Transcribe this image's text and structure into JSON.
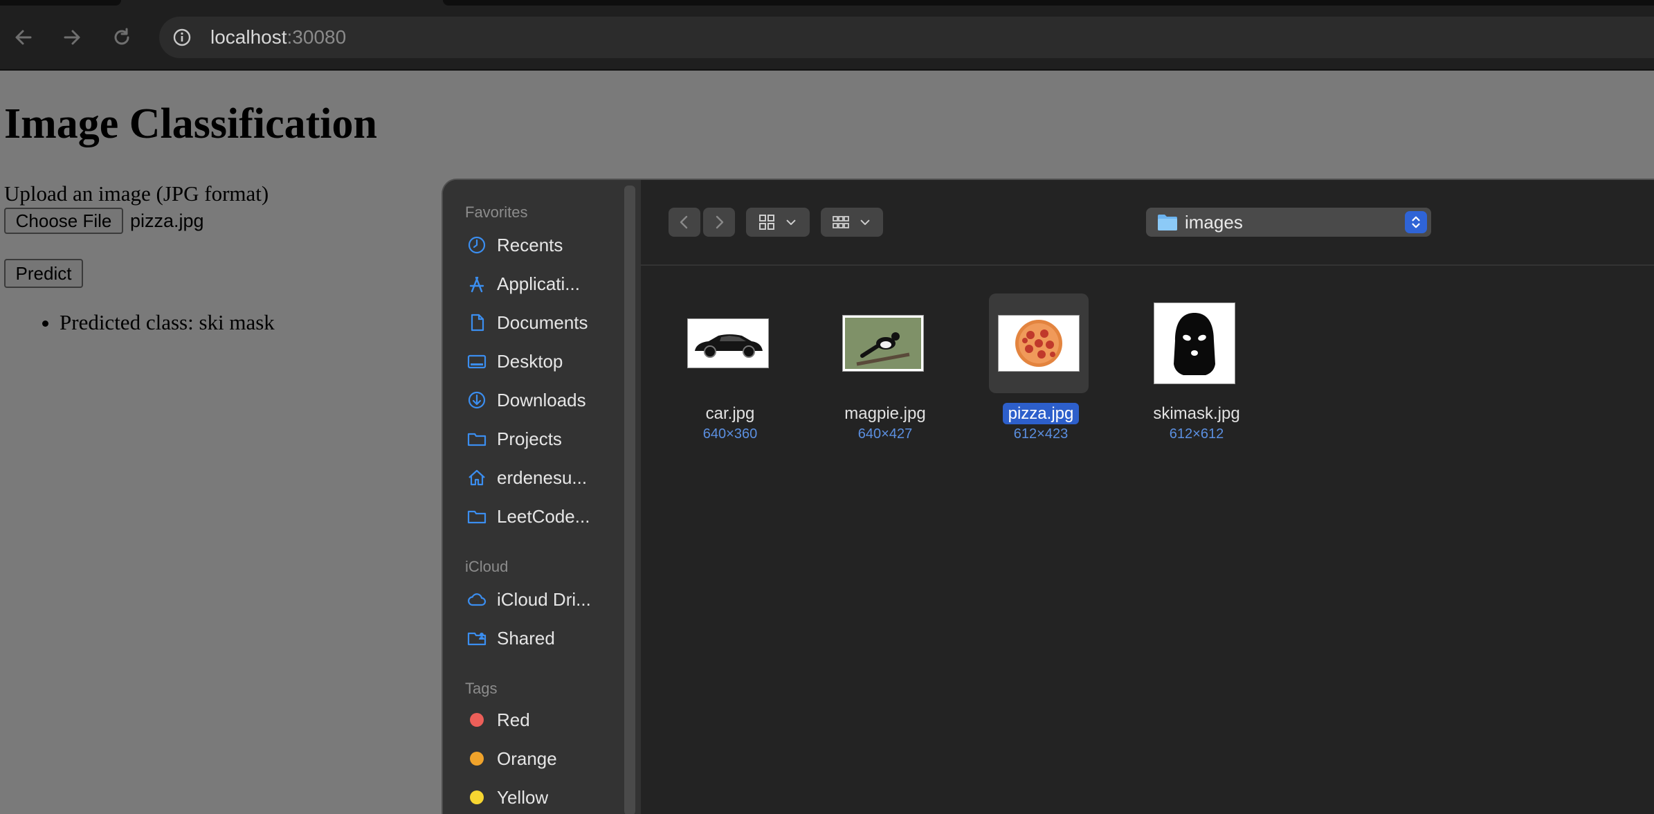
{
  "browser": {
    "url_host": "localhost",
    "url_port": ":30080"
  },
  "page": {
    "title": "Image Classification",
    "upload_label": "Upload an image (JPG format)",
    "choose_file_button": "Choose File",
    "chosen_file": "pizza.jpg",
    "predict_button": "Predict",
    "results": [
      "Predicted class: ski mask"
    ]
  },
  "dialog": {
    "sidebar": {
      "favorites_label": "Favorites",
      "favorites": [
        {
          "label": "Recents",
          "icon": "clock-icon"
        },
        {
          "label": "Applicati...",
          "icon": "applications-icon"
        },
        {
          "label": "Documents",
          "icon": "document-icon"
        },
        {
          "label": "Desktop",
          "icon": "desktop-icon"
        },
        {
          "label": "Downloads",
          "icon": "download-icon"
        },
        {
          "label": "Projects",
          "icon": "folder-icon"
        },
        {
          "label": "erdenesu...",
          "icon": "home-icon"
        },
        {
          "label": "LeetCode...",
          "icon": "folder-icon"
        }
      ],
      "icloud_label": "iCloud",
      "icloud": [
        {
          "label": "iCloud Dri...",
          "icon": "cloud-icon"
        },
        {
          "label": "Shared",
          "icon": "shared-folder-icon"
        }
      ],
      "tags_label": "Tags",
      "tags": [
        {
          "label": "Red",
          "color": "#ec5f59"
        },
        {
          "label": "Orange",
          "color": "#f0a32b"
        },
        {
          "label": "Yellow",
          "color": "#f7d631"
        }
      ]
    },
    "toolbar": {
      "current_folder": "images"
    },
    "files": [
      {
        "name": "car.jpg",
        "dims": "640×360",
        "selected": false
      },
      {
        "name": "magpie.jpg",
        "dims": "640×427",
        "selected": false
      },
      {
        "name": "pizza.jpg",
        "dims": "612×423",
        "selected": true
      },
      {
        "name": "skimask.jpg",
        "dims": "612×612",
        "selected": false
      }
    ]
  },
  "colors": {
    "accent": "#2d5fcb",
    "icon_blue": "#3b8ef0",
    "dims_text": "#5b8fe0"
  }
}
